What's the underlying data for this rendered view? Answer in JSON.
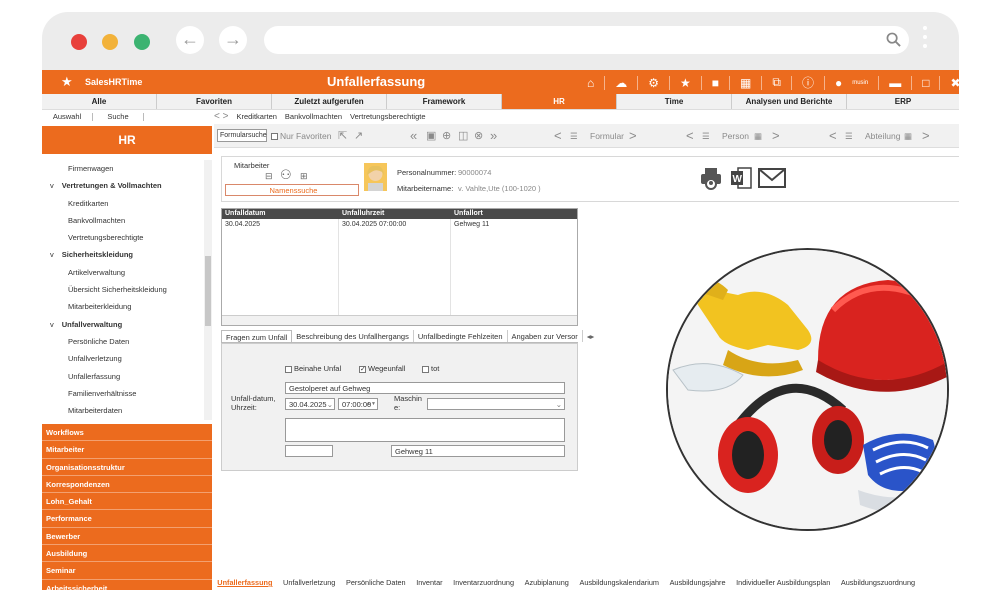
{
  "app": {
    "name": "SalesHRTime",
    "window_title": "Unfallerfassung",
    "user": "musin"
  },
  "menu": [
    "Alle",
    "Favoriten",
    "Zuletzt aufgerufen",
    "Framework",
    "HR",
    "Time",
    "Analysen und Berichte",
    "ERP"
  ],
  "menu_active": "HR",
  "subtabs": [
    "Auswahl",
    "Suche"
  ],
  "sidebar": {
    "header": "HR",
    "tree": [
      {
        "label": "Firmenwagen",
        "group": false
      },
      {
        "label": "Vertretungen & Vollmachten",
        "group": true
      },
      {
        "label": "Kreditkarten",
        "group": false
      },
      {
        "label": "Bankvollmachten",
        "group": false
      },
      {
        "label": "Vertretungsberechtigte",
        "group": false
      },
      {
        "label": "Sicherheitskleidung",
        "group": true
      },
      {
        "label": "Artikelverwaltung",
        "group": false
      },
      {
        "label": "Übersicht Sicherheitskleidung",
        "group": false
      },
      {
        "label": "Mitarbeiterkleidung",
        "group": false
      },
      {
        "label": "Unfallverwaltung",
        "group": true
      },
      {
        "label": "Persönliche Daten",
        "group": false
      },
      {
        "label": "Unfallverletzung",
        "group": false
      },
      {
        "label": "Unfallerfassung",
        "group": false
      },
      {
        "label": "Familienverhältnisse",
        "group": false
      },
      {
        "label": "Mitarbeiterdaten",
        "group": false
      }
    ],
    "modules": [
      "Workflows",
      "Mitarbeiter",
      "Organisationsstruktur",
      "Korrespondenzen",
      "Lohn_Gehalt",
      "Performance",
      "Bewerber",
      "Ausbildung",
      "Seminar",
      "Arbeitssicherheit"
    ]
  },
  "breadcrumb": [
    "Kreditkarten",
    "Bankvollmachten",
    "Vertretungsberechtigte"
  ],
  "toolbar": {
    "search_placeholder": "Formularsuche",
    "nur_favoriten": "Nur Favoriten",
    "formular": "Formular",
    "person": "Person",
    "abteilung": "Abteilung"
  },
  "employee": {
    "section_label": "Mitarbeiter",
    "search_button": "Namenssuche",
    "personalnummer_label": "Personalnummer:",
    "personalnummer": "90000074",
    "name_label": "Mitarbeitername:",
    "name": "v. Vahlte,Ute (100-1020 )"
  },
  "grid": {
    "columns": [
      "Unfalldatum",
      "Unfalluhrzeit",
      "Unfallort"
    ],
    "rows": [
      [
        "30.04.2025",
        "30.04.2025 07:00:00",
        "Gehweg 11"
      ]
    ]
  },
  "tabs": [
    "Fragen zum Unfall",
    "Beschreibung des Unfallhergangs",
    "Unfallbedingte Fehlzeiten",
    "Angaben zur Versor"
  ],
  "form": {
    "checkbox_beinahe": "Beinahe Unfal",
    "checkbox_wegeunfall": "Wegeunfall",
    "checkbox_tot": "tot",
    "wegeunfall_checked": true,
    "description": "Gestolperet auf Gehweg",
    "date_label": "Unfall-datum, Uhrzeit:",
    "date": "30.04.2025",
    "time": "07:00:00",
    "maschine_label": "Maschin e:",
    "ort": "Gehweg 11"
  },
  "bottom_tabs": [
    "Unfallerfassung",
    "Unfallverletzung",
    "Persönliche Daten",
    "Inventar",
    "Inventarzuordnung",
    "Azubiplanung",
    "Ausbildungskalendarium",
    "Ausbildungsjahre",
    "Individueller Ausbildungsplan",
    "Ausbildungszuordnung"
  ],
  "bottom_active": "Unfallerfassung",
  "colors": {
    "accent": "#ec6b1e",
    "helmet": "#d9231f",
    "glove": "#f2c320",
    "mask": "#2a54c9"
  },
  "icons": [
    "home-icon",
    "cloud-icon",
    "gear-icon",
    "star-icon",
    "lock-icon",
    "calendar-icon",
    "copy-icon",
    "info-icon",
    "user-icon",
    "minimize-icon",
    "maximize-icon",
    "close-icon",
    "printer-icon",
    "word-icon",
    "mail-icon"
  ]
}
